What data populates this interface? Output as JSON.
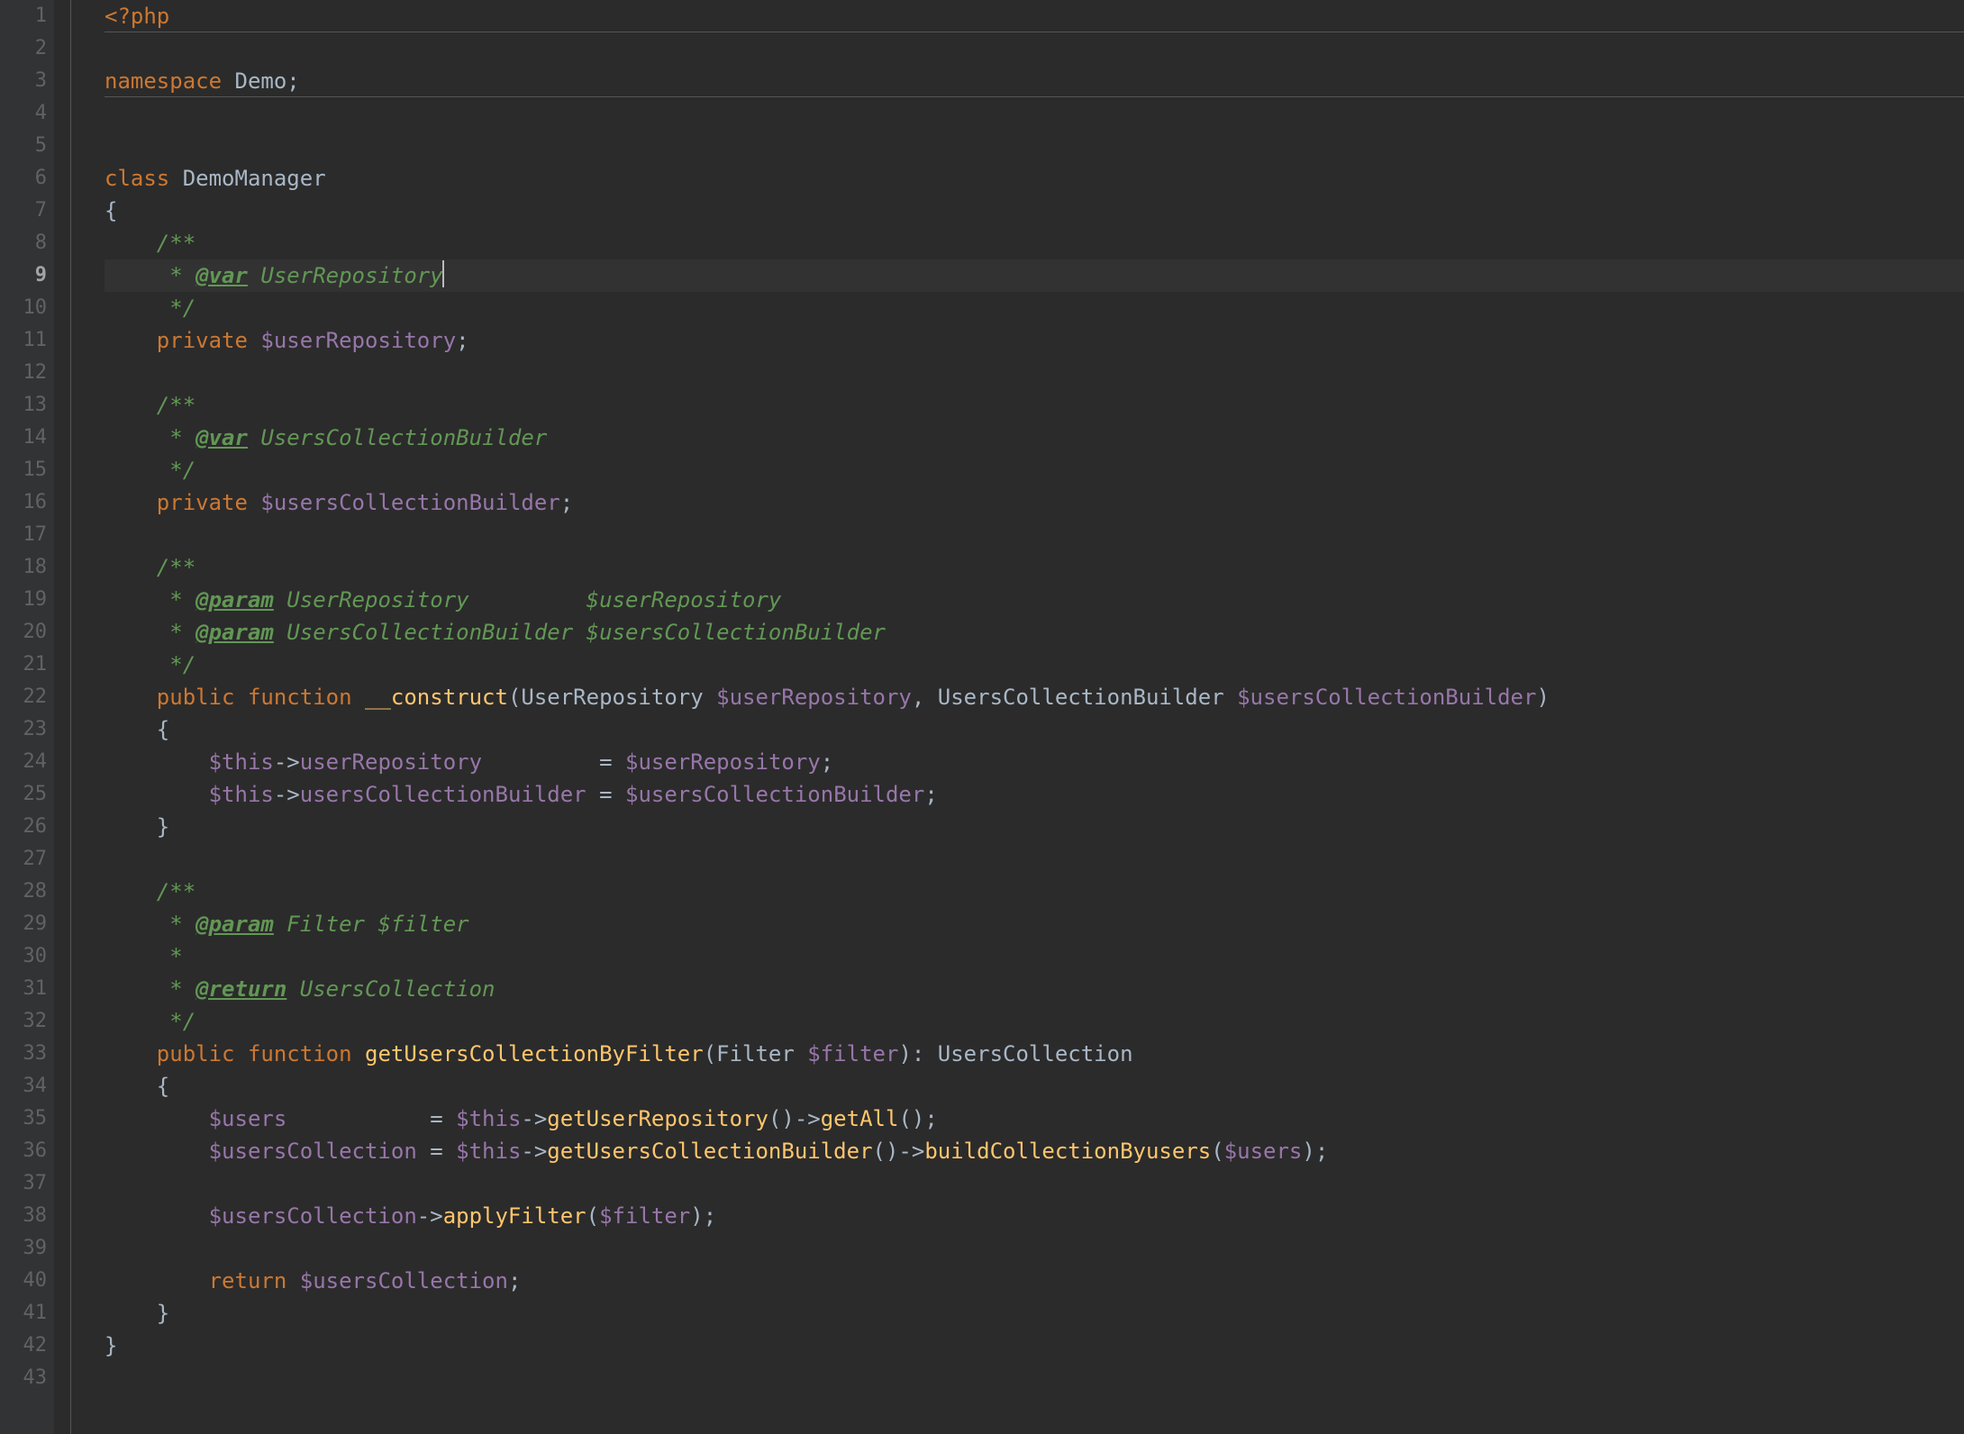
{
  "currentLine": 9,
  "lineNumbers": [
    1,
    2,
    3,
    4,
    5,
    6,
    7,
    8,
    9,
    10,
    11,
    12,
    13,
    14,
    15,
    16,
    17,
    18,
    19,
    20,
    21,
    22,
    23,
    24,
    25,
    26,
    27,
    28,
    29,
    30,
    31,
    32,
    33,
    34,
    35,
    36,
    37,
    38,
    39,
    40,
    41,
    42,
    43
  ],
  "code": {
    "l1_php": "<?php",
    "l3_ns": "namespace",
    "l3_demo": " Demo;",
    "l6_class": "class",
    "l6_name": " DemoManager",
    "l7_brace": "{",
    "l8_doc": "    /**",
    "l9_star": "     * ",
    "l9_tag": "@var",
    "l9_type": " UserRepository",
    "l10_doc": "     */",
    "l11_priv": "    private",
    "l11_var": " $userRepository",
    "l11_semi": ";",
    "l13_doc": "    /**",
    "l14_star": "     * ",
    "l14_tag": "@var",
    "l14_type": " UsersCollectionBuilder",
    "l15_doc": "     */",
    "l16_priv": "    private",
    "l16_var": " $usersCollectionBuilder",
    "l16_semi": ";",
    "l18_doc": "    /**",
    "l19_star": "     * ",
    "l19_tag": "@param",
    "l19_type": " UserRepository         $userRepository",
    "l20_star": "     * ",
    "l20_tag": "@param",
    "l20_type": " UsersCollectionBuilder $usersCollectionBuilder",
    "l21_doc": "     */",
    "l22_pub": "    public",
    "l22_fn": " function",
    "l22_name": " __construct",
    "l22_p1": "(UserRepository ",
    "l22_v1": "$userRepository",
    "l22_c": ", UsersCollectionBuilder ",
    "l22_v2": "$usersCollectionBuilder",
    "l22_close": ")",
    "l23_brace": "    {",
    "l24_this": "        $this",
    "l24_arrow": "->",
    "l24_prop": "userRepository",
    "l24_pad": "         = ",
    "l24_val": "$userRepository",
    "l24_semi": ";",
    "l25_this": "        $this",
    "l25_arrow": "->",
    "l25_prop": "usersCollectionBuilder",
    "l25_pad": " = ",
    "l25_val": "$usersCollectionBuilder",
    "l25_semi": ";",
    "l26_brace": "    }",
    "l28_doc": "    /**",
    "l29_star": "     * ",
    "l29_tag": "@param",
    "l29_type": " Filter $filter",
    "l30_star": "     *",
    "l31_star": "     * ",
    "l31_tag": "@return",
    "l31_type": " UsersCollection",
    "l32_doc": "     */",
    "l33_pub": "    public",
    "l33_fn": " function",
    "l33_name": " getUsersCollectionByFilter",
    "l33_p1": "(Filter ",
    "l33_v1": "$filter",
    "l33_close": "): UsersCollection",
    "l34_brace": "    {",
    "l35_var": "        $users",
    "l35_pad": "           = ",
    "l35_this": "$this",
    "l35_arrow": "->",
    "l35_fn1": "getUserRepository",
    "l35_mid": "()->",
    "l35_fn2": "getAll",
    "l35_end": "();",
    "l36_var": "        $usersCollection",
    "l36_pad": " = ",
    "l36_this": "$this",
    "l36_arrow": "->",
    "l36_fn1": "getUsersCollectionBuilder",
    "l36_mid": "()->",
    "l36_fn2": "buildCollectionByusers",
    "l36_p": "(",
    "l36_arg": "$users",
    "l36_end": ");",
    "l38_var": "        $usersCollection",
    "l38_arrow": "->",
    "l38_fn": "applyFilter",
    "l38_p": "(",
    "l38_arg": "$filter",
    "l38_end": ");",
    "l40_ret": "        return",
    "l40_var": " $usersCollection",
    "l40_semi": ";",
    "l41_brace": "    }",
    "l42_brace": "}"
  }
}
